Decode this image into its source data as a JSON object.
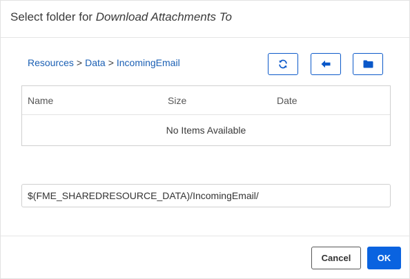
{
  "dialog": {
    "title_prefix": "Select folder for ",
    "title_target": "Download Attachments To"
  },
  "breadcrumb": {
    "items": [
      "Resources",
      "Data",
      "IncomingEmail"
    ],
    "separator": ">"
  },
  "toolbar": {
    "refresh_icon": "refresh-icon",
    "back_icon": "arrow-left-icon",
    "folder_icon": "folder-icon"
  },
  "table": {
    "columns": [
      "Name",
      "Size",
      "Date"
    ],
    "empty_message": "No Items Available"
  },
  "path": {
    "value": "$(FME_SHAREDRESOURCE_DATA)/IncomingEmail/"
  },
  "buttons": {
    "cancel": "Cancel",
    "ok": "OK"
  },
  "colors": {
    "accent": "#0a63e0",
    "link": "#1a5fb4",
    "border": "#cfcfcf"
  }
}
